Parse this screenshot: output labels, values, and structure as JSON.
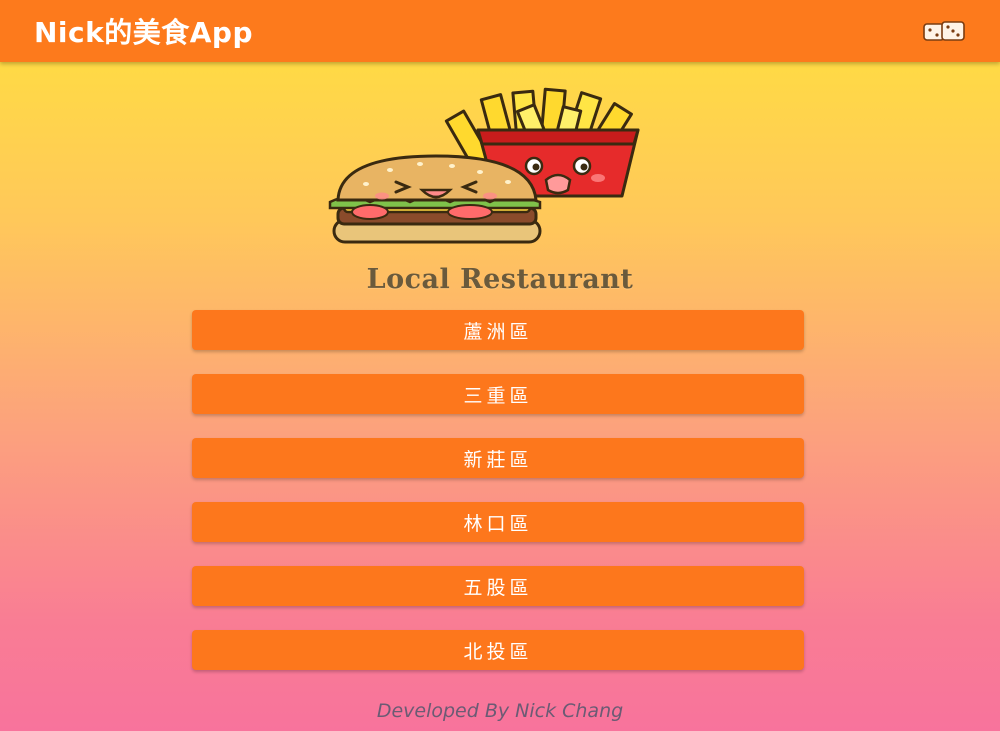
{
  "appbar": {
    "title": "Nick的美食App",
    "dice_icon": "dice-icon",
    "color": "#fd7a1c"
  },
  "hero": {
    "burger_icon": "burger-icon",
    "fries_icon": "fries-icon"
  },
  "heading": "Local Restaurant",
  "districts": [
    {
      "label": "蘆洲區"
    },
    {
      "label": "三重區"
    },
    {
      "label": "新莊區"
    },
    {
      "label": "林口區"
    },
    {
      "label": "五股區"
    },
    {
      "label": "北投區"
    }
  ],
  "footer": "Developed By Nick Chang",
  "colors": {
    "button": "#fd771c",
    "gradient_top": "#ffe13d",
    "gradient_bottom": "#f8739c"
  }
}
